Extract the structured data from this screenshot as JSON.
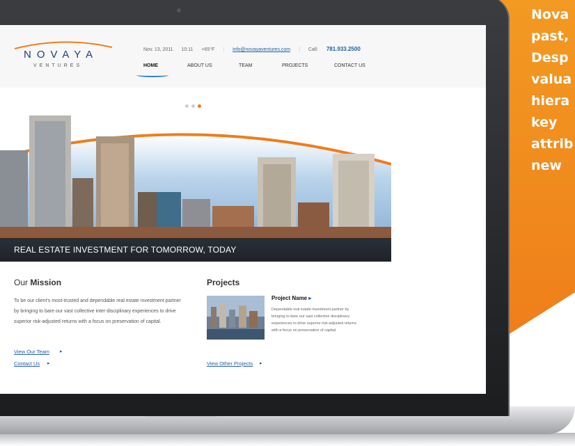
{
  "promo": {
    "lines": [
      "Nova",
      "past,",
      "Desp",
      "valua",
      "hiera",
      "key",
      "attrib",
      "new"
    ]
  },
  "site": {
    "logo": {
      "main": "NOVAYA",
      "sub": "VENTURES"
    },
    "topline": {
      "date": "Nov. 13, 2011",
      "time": "10:11",
      "temp": "+65°F",
      "email": "info@novayaventures.com",
      "call_label": "Call:",
      "call_value": "781.933.2500"
    },
    "nav": [
      "HOME",
      "ABOUT US",
      "TEAM",
      "PROJECTS",
      "CONTACT US"
    ],
    "slider": {
      "active_dot": 3
    },
    "hero_caption": "REAL ESTATE INVESTMENT FOR TOMORROW, TODAY",
    "mission": {
      "title_light": "Our",
      "title_bold": "Mission",
      "text": "To be our client's most-trusted and dependable real estate investment partner by bringing to bare our vast collective inter-disciplinary experiences to drive superior risk-adjusted returns with a focus on preservation of capital.",
      "link_team": "View Our Team",
      "link_contact": "Contact Us"
    },
    "projects": {
      "title": "Projects",
      "name": "Project Name",
      "desc": "Dependable real estate investment partner by bringing to bare our vast collective disciplinary experiences to drive superior risk-adjusted returns with a focus on preservation of capital.",
      "link_other": "View Other Projects"
    }
  },
  "colors": {
    "accent_orange": "#ef7d1a",
    "link_blue": "#1f5fa8",
    "logo_navy": "#1c3f7a"
  }
}
